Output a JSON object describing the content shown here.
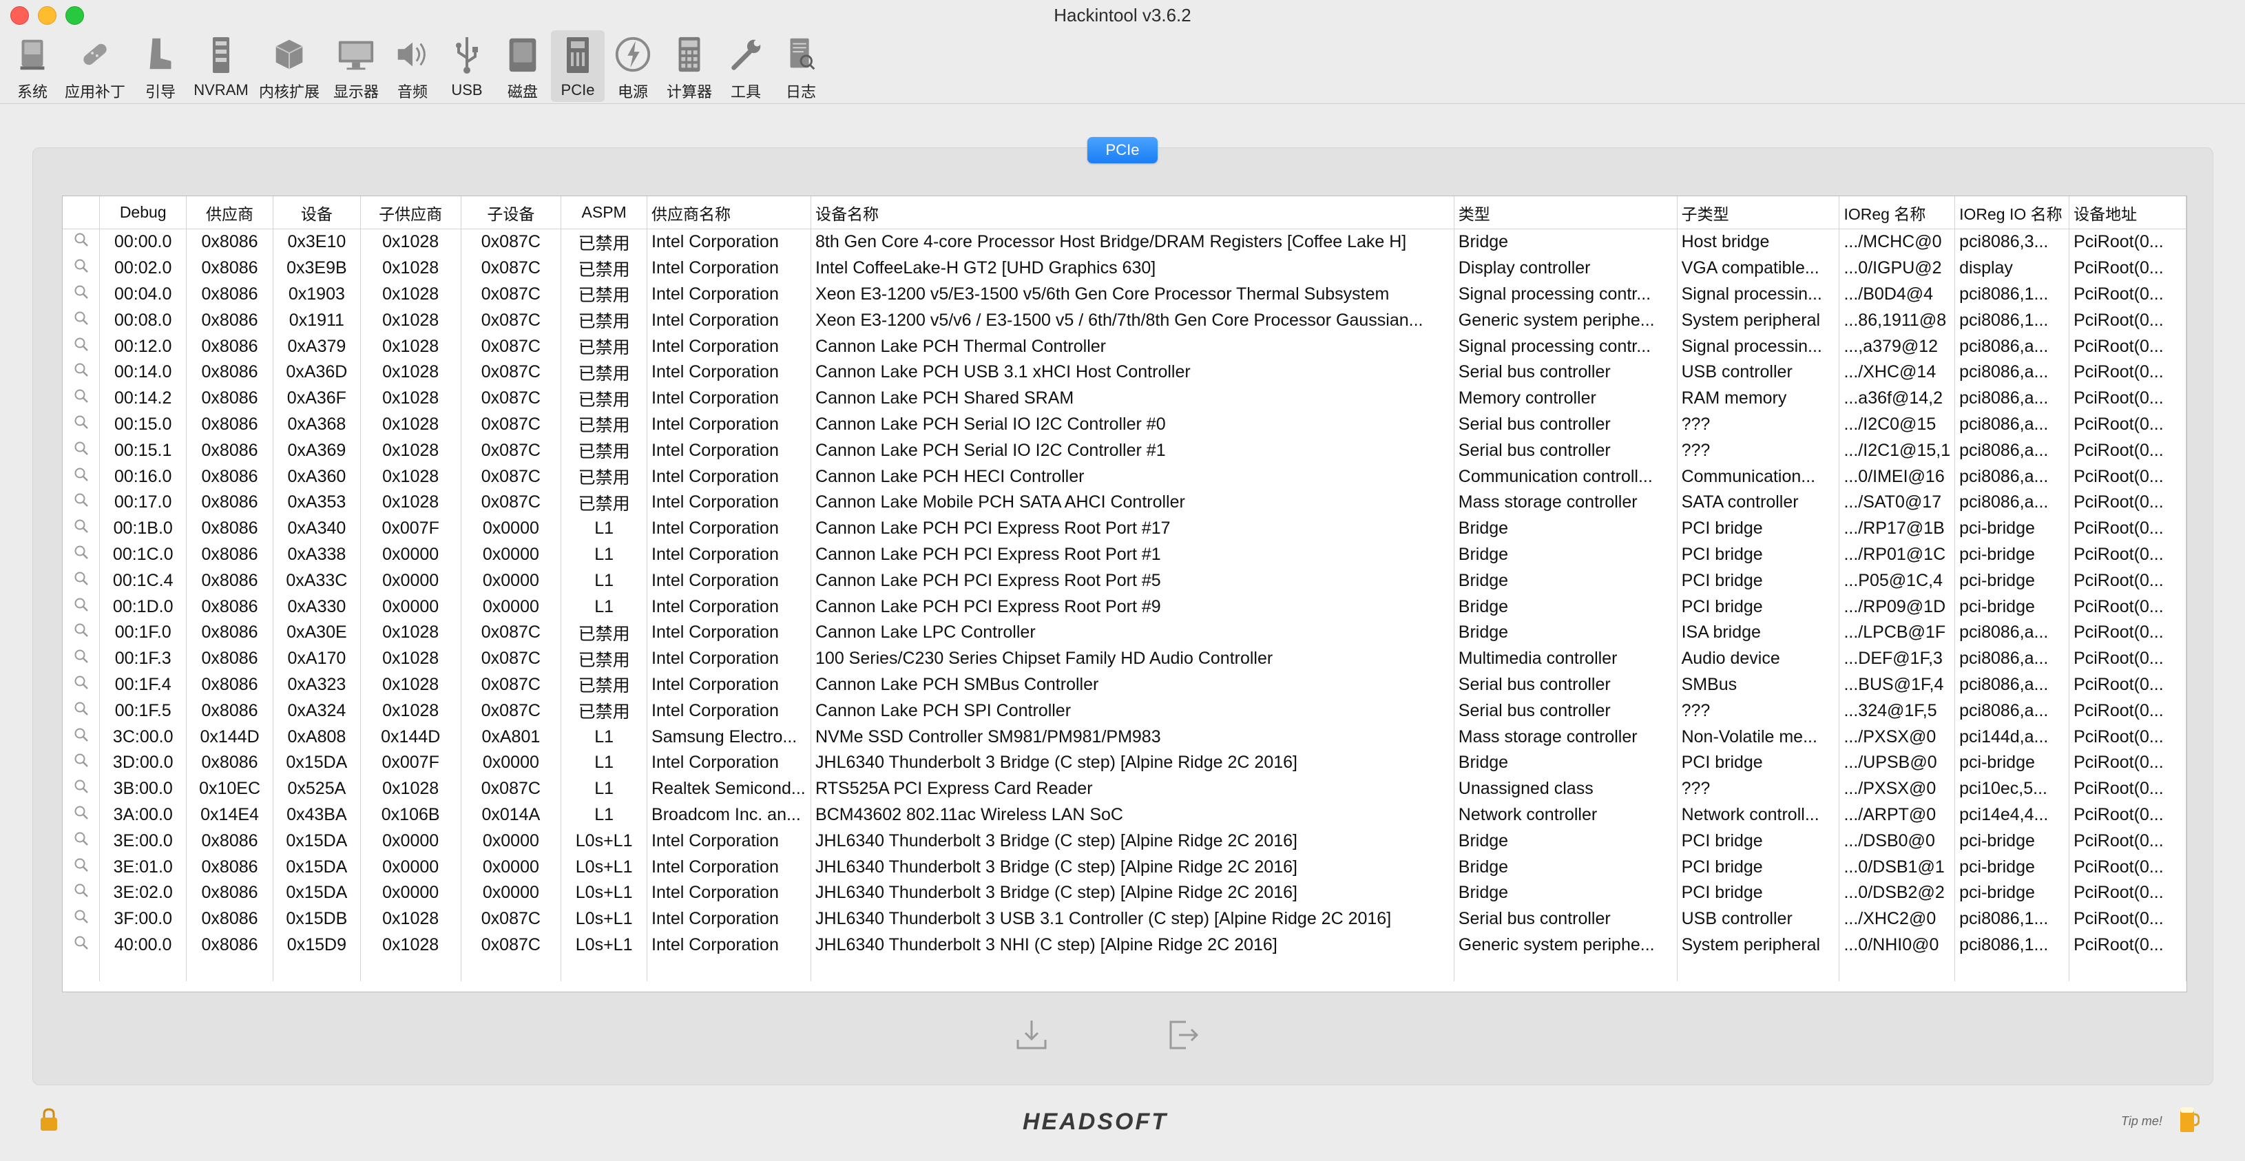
{
  "window": {
    "title": "Hackintool v3.6.2"
  },
  "toolbar": {
    "items": [
      {
        "label": "系统",
        "icon": "system-icon"
      },
      {
        "label": "应用补丁",
        "icon": "patch-icon"
      },
      {
        "label": "引导",
        "icon": "boot-icon"
      },
      {
        "label": "NVRAM",
        "icon": "nvram-icon"
      },
      {
        "label": "内核扩展",
        "icon": "kext-icon"
      },
      {
        "label": "显示器",
        "icon": "display-icon"
      },
      {
        "label": "音频",
        "icon": "audio-icon"
      },
      {
        "label": "USB",
        "icon": "usb-icon"
      },
      {
        "label": "磁盘",
        "icon": "disk-icon"
      },
      {
        "label": "PCIe",
        "icon": "pcie-icon",
        "active": true
      },
      {
        "label": "电源",
        "icon": "power-icon"
      },
      {
        "label": "计算器",
        "icon": "calculator-icon"
      },
      {
        "label": "工具",
        "icon": "tools-icon"
      },
      {
        "label": "日志",
        "icon": "log-icon"
      }
    ]
  },
  "segment": {
    "label": "PCIe"
  },
  "table": {
    "headers": [
      "",
      "Debug",
      "供应商",
      "设备",
      "子供应商",
      "子设备",
      "ASPM",
      "供应商名称",
      "设备名称",
      "类型",
      "子类型",
      "IOReg 名称",
      "IOReg IO 名称",
      "设备地址"
    ],
    "rows": [
      [
        "00:00.0",
        "0x8086",
        "0x3E10",
        "0x1028",
        "0x087C",
        "已禁用",
        "Intel Corporation",
        "8th Gen Core 4-core Processor Host Bridge/DRAM Registers [Coffee Lake H]",
        "Bridge",
        "Host bridge",
        ".../MCHC@0",
        "pci8086,3...",
        "PciRoot(0..."
      ],
      [
        "00:02.0",
        "0x8086",
        "0x3E9B",
        "0x1028",
        "0x087C",
        "已禁用",
        "Intel Corporation",
        "Intel CoffeeLake-H GT2 [UHD Graphics 630]",
        "Display controller",
        "VGA compatible...",
        "...0/IGPU@2",
        "display",
        "PciRoot(0..."
      ],
      [
        "00:04.0",
        "0x8086",
        "0x1903",
        "0x1028",
        "0x087C",
        "已禁用",
        "Intel Corporation",
        "Xeon E3-1200 v5/E3-1500 v5/6th Gen Core Processor Thermal Subsystem",
        "Signal processing contr...",
        "Signal processin...",
        ".../B0D4@4",
        "pci8086,1...",
        "PciRoot(0..."
      ],
      [
        "00:08.0",
        "0x8086",
        "0x1911",
        "0x1028",
        "0x087C",
        "已禁用",
        "Intel Corporation",
        "Xeon E3-1200 v5/v6 / E3-1500 v5 / 6th/7th/8th Gen Core Processor Gaussian...",
        "Generic system periphe...",
        "System peripheral",
        "...86,1911@8",
        "pci8086,1...",
        "PciRoot(0..."
      ],
      [
        "00:12.0",
        "0x8086",
        "0xA379",
        "0x1028",
        "0x087C",
        "已禁用",
        "Intel Corporation",
        "Cannon Lake PCH Thermal Controller",
        "Signal processing contr...",
        "Signal processin...",
        "...,a379@12",
        "pci8086,a...",
        "PciRoot(0..."
      ],
      [
        "00:14.0",
        "0x8086",
        "0xA36D",
        "0x1028",
        "0x087C",
        "已禁用",
        "Intel Corporation",
        "Cannon Lake PCH USB 3.1 xHCI Host Controller",
        "Serial bus controller",
        "USB controller",
        ".../XHC@14",
        "pci8086,a...",
        "PciRoot(0..."
      ],
      [
        "00:14.2",
        "0x8086",
        "0xA36F",
        "0x1028",
        "0x087C",
        "已禁用",
        "Intel Corporation",
        "Cannon Lake PCH Shared SRAM",
        "Memory controller",
        "RAM memory",
        "...a36f@14,2",
        "pci8086,a...",
        "PciRoot(0..."
      ],
      [
        "00:15.0",
        "0x8086",
        "0xA368",
        "0x1028",
        "0x087C",
        "已禁用",
        "Intel Corporation",
        "Cannon Lake PCH Serial IO I2C Controller #0",
        "Serial bus controller",
        "???",
        ".../I2C0@15",
        "pci8086,a...",
        "PciRoot(0..."
      ],
      [
        "00:15.1",
        "0x8086",
        "0xA369",
        "0x1028",
        "0x087C",
        "已禁用",
        "Intel Corporation",
        "Cannon Lake PCH Serial IO I2C Controller #1",
        "Serial bus controller",
        "???",
        ".../I2C1@15,1",
        "pci8086,a...",
        "PciRoot(0..."
      ],
      [
        "00:16.0",
        "0x8086",
        "0xA360",
        "0x1028",
        "0x087C",
        "已禁用",
        "Intel Corporation",
        "Cannon Lake PCH HECI Controller",
        "Communication controll...",
        "Communication...",
        "...0/IMEI@16",
        "pci8086,a...",
        "PciRoot(0..."
      ],
      [
        "00:17.0",
        "0x8086",
        "0xA353",
        "0x1028",
        "0x087C",
        "已禁用",
        "Intel Corporation",
        "Cannon Lake Mobile PCH SATA AHCI Controller",
        "Mass storage controller",
        "SATA controller",
        ".../SAT0@17",
        "pci8086,a...",
        "PciRoot(0..."
      ],
      [
        "00:1B.0",
        "0x8086",
        "0xA340",
        "0x007F",
        "0x0000",
        "L1",
        "Intel Corporation",
        "Cannon Lake PCH PCI Express Root Port #17",
        "Bridge",
        "PCI bridge",
        ".../RP17@1B",
        "pci-bridge",
        "PciRoot(0..."
      ],
      [
        "00:1C.0",
        "0x8086",
        "0xA338",
        "0x0000",
        "0x0000",
        "L1",
        "Intel Corporation",
        "Cannon Lake PCH PCI Express Root Port #1",
        "Bridge",
        "PCI bridge",
        ".../RP01@1C",
        "pci-bridge",
        "PciRoot(0..."
      ],
      [
        "00:1C.4",
        "0x8086",
        "0xA33C",
        "0x0000",
        "0x0000",
        "L1",
        "Intel Corporation",
        "Cannon Lake PCH PCI Express Root Port #5",
        "Bridge",
        "PCI bridge",
        "...P05@1C,4",
        "pci-bridge",
        "PciRoot(0..."
      ],
      [
        "00:1D.0",
        "0x8086",
        "0xA330",
        "0x0000",
        "0x0000",
        "L1",
        "Intel Corporation",
        "Cannon Lake PCH PCI Express Root Port #9",
        "Bridge",
        "PCI bridge",
        ".../RP09@1D",
        "pci-bridge",
        "PciRoot(0..."
      ],
      [
        "00:1F.0",
        "0x8086",
        "0xA30E",
        "0x1028",
        "0x087C",
        "已禁用",
        "Intel Corporation",
        "Cannon Lake LPC Controller",
        "Bridge",
        "ISA bridge",
        ".../LPCB@1F",
        "pci8086,a...",
        "PciRoot(0..."
      ],
      [
        "00:1F.3",
        "0x8086",
        "0xA170",
        "0x1028",
        "0x087C",
        "已禁用",
        "Intel Corporation",
        "100 Series/C230 Series Chipset Family HD Audio Controller",
        "Multimedia controller",
        "Audio device",
        "...DEF@1F,3",
        "pci8086,a...",
        "PciRoot(0..."
      ],
      [
        "00:1F.4",
        "0x8086",
        "0xA323",
        "0x1028",
        "0x087C",
        "已禁用",
        "Intel Corporation",
        "Cannon Lake PCH SMBus Controller",
        "Serial bus controller",
        "SMBus",
        "...BUS@1F,4",
        "pci8086,a...",
        "PciRoot(0..."
      ],
      [
        "00:1F.5",
        "0x8086",
        "0xA324",
        "0x1028",
        "0x087C",
        "已禁用",
        "Intel Corporation",
        "Cannon Lake PCH SPI Controller",
        "Serial bus controller",
        "???",
        "...324@1F,5",
        "pci8086,a...",
        "PciRoot(0..."
      ],
      [
        "3C:00.0",
        "0x144D",
        "0xA808",
        "0x144D",
        "0xA801",
        "L1",
        "Samsung Electro...",
        "NVMe SSD Controller SM981/PM981/PM983",
        "Mass storage controller",
        "Non-Volatile me...",
        ".../PXSX@0",
        "pci144d,a...",
        "PciRoot(0..."
      ],
      [
        "3D:00.0",
        "0x8086",
        "0x15DA",
        "0x007F",
        "0x0000",
        "L1",
        "Intel Corporation",
        "JHL6340 Thunderbolt 3 Bridge (C step) [Alpine Ridge 2C 2016]",
        "Bridge",
        "PCI bridge",
        ".../UPSB@0",
        "pci-bridge",
        "PciRoot(0..."
      ],
      [
        "3B:00.0",
        "0x10EC",
        "0x525A",
        "0x1028",
        "0x087C",
        "L1",
        "Realtek Semicond...",
        "RTS525A PCI Express Card Reader",
        "Unassigned class",
        "???",
        ".../PXSX@0",
        "pci10ec,5...",
        "PciRoot(0..."
      ],
      [
        "3A:00.0",
        "0x14E4",
        "0x43BA",
        "0x106B",
        "0x014A",
        "L1",
        "Broadcom Inc. an...",
        "BCM43602 802.11ac Wireless LAN SoC",
        "Network controller",
        "Network controll...",
        ".../ARPT@0",
        "pci14e4,4...",
        "PciRoot(0..."
      ],
      [
        "3E:00.0",
        "0x8086",
        "0x15DA",
        "0x0000",
        "0x0000",
        "L0s+L1",
        "Intel Corporation",
        "JHL6340 Thunderbolt 3 Bridge (C step) [Alpine Ridge 2C 2016]",
        "Bridge",
        "PCI bridge",
        ".../DSB0@0",
        "pci-bridge",
        "PciRoot(0..."
      ],
      [
        "3E:01.0",
        "0x8086",
        "0x15DA",
        "0x0000",
        "0x0000",
        "L0s+L1",
        "Intel Corporation",
        "JHL6340 Thunderbolt 3 Bridge (C step) [Alpine Ridge 2C 2016]",
        "Bridge",
        "PCI bridge",
        "...0/DSB1@1",
        "pci-bridge",
        "PciRoot(0..."
      ],
      [
        "3E:02.0",
        "0x8086",
        "0x15DA",
        "0x0000",
        "0x0000",
        "L0s+L1",
        "Intel Corporation",
        "JHL6340 Thunderbolt 3 Bridge (C step) [Alpine Ridge 2C 2016]",
        "Bridge",
        "PCI bridge",
        "...0/DSB2@2",
        "pci-bridge",
        "PciRoot(0..."
      ],
      [
        "3F:00.0",
        "0x8086",
        "0x15DB",
        "0x1028",
        "0x087C",
        "L0s+L1",
        "Intel Corporation",
        "JHL6340 Thunderbolt 3 USB 3.1 Controller (C step) [Alpine Ridge 2C 2016]",
        "Serial bus controller",
        "USB controller",
        ".../XHC2@0",
        "pci8086,1...",
        "PciRoot(0..."
      ],
      [
        "40:00.0",
        "0x8086",
        "0x15D9",
        "0x1028",
        "0x087C",
        "L0s+L1",
        "Intel Corporation",
        "JHL6340 Thunderbolt 3 NHI (C step) [Alpine Ridge 2C 2016]",
        "Generic system periphe...",
        "System peripheral",
        "...0/NHI0@0",
        "pci8086,1...",
        "PciRoot(0..."
      ]
    ]
  },
  "footer": {
    "brand": "HEADSOFT",
    "tip": "Tip me!",
    "export_icon": "export-icon",
    "exit_icon": "exit-icon",
    "lock_icon": "lock-icon",
    "beer_icon": "beer-icon"
  },
  "colors": {
    "accent": "#1a7ef5",
    "background": "#ececec",
    "panel": "#e2e2e2"
  }
}
